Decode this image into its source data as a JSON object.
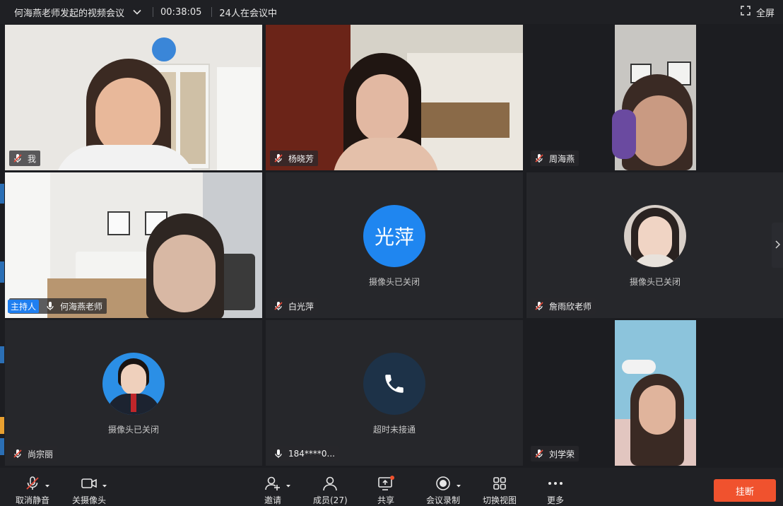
{
  "titlebar": {
    "meeting_title": "何海燕老师发起的视频会议",
    "elapsed": "00:38:05",
    "participants": "24人在会议中",
    "fullscreen_label": "全屏"
  },
  "tiles": [
    {
      "name": "我",
      "mic": "muted",
      "mode": "video"
    },
    {
      "name": "杨晓芳",
      "mic": "muted",
      "mode": "video"
    },
    {
      "name": "周海燕",
      "mic": "muted",
      "mode": "video"
    },
    {
      "name": "何海燕老师",
      "mic": "on",
      "mode": "video",
      "badge": "主持人"
    },
    {
      "name": "白光萍",
      "mic": "muted",
      "mode": "camera-off",
      "avatar_text": "光萍",
      "status": "摄像头已关闭"
    },
    {
      "name": "詹雨欣老师",
      "mic": "muted",
      "mode": "camera-off",
      "status": "摄像头已关闭"
    },
    {
      "name": "尚宗丽",
      "mic": "muted",
      "mode": "camera-off",
      "status": "摄像头已关闭"
    },
    {
      "name": "184****0...",
      "mic": "on",
      "mode": "phone",
      "status": "超时未接通"
    },
    {
      "name": "刘学荣",
      "mic": "muted",
      "mode": "video"
    }
  ],
  "toolbar": {
    "unmute": "取消静音",
    "camera_off": "关摄像头",
    "invite": "邀请",
    "members": "成员(27)",
    "share": "共享",
    "record": "会议录制",
    "switch_view": "切换视图",
    "more": "更多",
    "hangup": "挂断"
  },
  "colors": {
    "accent": "#1f7ff0",
    "hangup": "#f0522e",
    "muted_mic": "#e84b3a",
    "share_dot": "#f0522e"
  }
}
